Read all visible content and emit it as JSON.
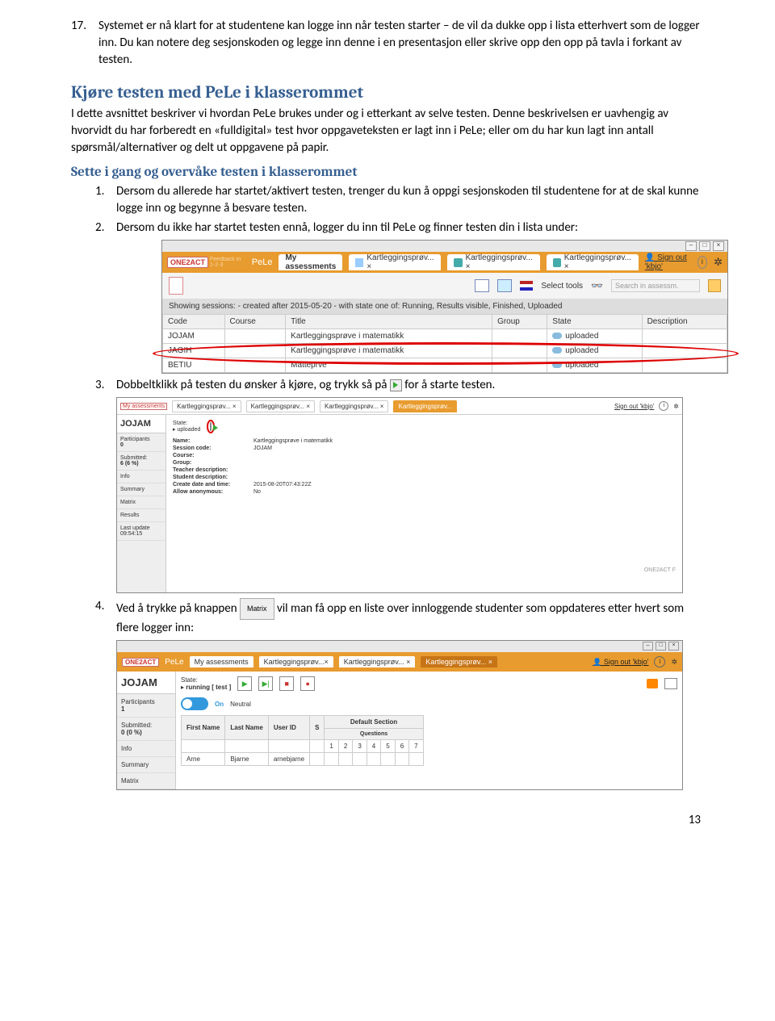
{
  "item17_num": "17.",
  "item17_text": "Systemet er nå klart for at studentene kan logge inn når testen starter – de vil da dukke opp i lista etterhvert som de logger inn. Du kan notere deg sesjonskoden og legge inn denne i en presentasjon eller skrive opp den opp på tavla i forkant av testen.",
  "h_kjor": "Kjøre testen med PeLe i klasserommet",
  "p_kjor": "I dette avsnittet beskriver vi hvordan PeLe brukes under og i etterkant av selve testen. Denne beskrivelsen er uavhengig av hvorvidt du har forberedt en «fulldigital» test hvor oppgaveteksten er lagt inn i PeLe; eller om du har kun lagt inn antall spørsmål/alternativer og delt ut oppgavene på papir.",
  "h_sette": "Sette i gang og overvåke testen i klasserommet",
  "ol": [
    {
      "n": "1.",
      "t": "Dersom du allerede har startet/aktivert testen, trenger du kun å oppgi sesjonskoden til studentene for at de skal kunne logge inn og begynne å besvare testen."
    },
    {
      "n": "2.",
      "t": "Dersom du ikke har startet testen ennå, logger du inn til PeLe og finner testen din i lista under:"
    }
  ],
  "ol3_n": "3.",
  "ol3_a": "Dobbeltklikk på testen du ønsker å kjøre, og trykk så på ",
  "ol3_b": " for å starte testen.",
  "ol4_n": "4.",
  "ol4_a": "Ved å trykke på knappen ",
  "ol4_btn": "Matrix",
  "ol4_b": " vil man få opp en liste over innloggende studenter som oppdateres etter hvert som flere logger inn:",
  "s1": {
    "logo": "ONE2ACT",
    "pele": "PeLe",
    "fb": "Feedback in 1-2-3",
    "tabs": [
      "My assessments",
      "Kartleggingsprøv... ×",
      "Kartleggingsprøv... ×",
      "Kartleggingsprøv... ×"
    ],
    "signout": "Sign out 'kbjo'",
    "select_tools": "Select tools",
    "search_ph": "Search in assessm.",
    "band": "Showing sessions: - created after 2015-05-20 - with state one of: Running, Results visible, Finished, Uploaded",
    "cols": [
      "Code",
      "Course",
      "Title",
      "Group",
      "State",
      "Description"
    ],
    "rows": [
      {
        "code": "JOJAM",
        "title": "Kartleggingsprøve i matematikk",
        "state": "uploaded"
      },
      {
        "code": "JAGIH",
        "title": "Kartleggingsprøve i matematikk",
        "state": "uploaded"
      },
      {
        "code": "BETIU",
        "title": "Matteprve",
        "state": "uploaded"
      }
    ]
  },
  "s2": {
    "tabs": [
      "My assessments",
      "Kartleggingsprøv... ×",
      "Kartleggingsprøv... ×",
      "Kartleggingsprøv... ×",
      "Kartleggingsprøv..."
    ],
    "signout": "Sign out 'kbjo'",
    "code": "JOJAM",
    "state_lbl": "State:",
    "state_val": "uploaded",
    "side": [
      {
        "l": "Participants",
        "v": "0"
      },
      {
        "l": "Submitted:",
        "v": "6 (6 %)"
      },
      {
        "l": "Info",
        "v": ""
      },
      {
        "l": "Summary",
        "v": ""
      },
      {
        "l": "Matrix",
        "v": ""
      },
      {
        "l": "Results",
        "v": ""
      },
      {
        "l": "Last update",
        "v": "09:54:15"
      }
    ],
    "kv": [
      [
        "Name:",
        "Kartleggingsprøve i matematikk"
      ],
      [
        "Session code:",
        "JOJAM"
      ],
      [
        "Course:",
        ""
      ],
      [
        "Group:",
        ""
      ],
      [
        "Teacher description:",
        ""
      ],
      [
        "Student description:",
        ""
      ],
      [
        "Create date and time:",
        "2015-08-20T07:43:22Z"
      ],
      [
        "Allow anonymous:",
        "No"
      ]
    ],
    "footer": "ONE2ACT F"
  },
  "s3": {
    "logo": "ONE2ACT",
    "pele": "PeLe",
    "tabs": [
      "My assessments",
      "Kartleggingsprøv...×",
      "Kartleggingsprøv... ×",
      "Kartleggingsprøv..."
    ],
    "signout": "Sign out 'kbjo'",
    "code": "JOJAM",
    "state_lbl": "State:",
    "state_val": "running [ test ]",
    "side": [
      {
        "l": "Participants",
        "v": "1"
      },
      {
        "l": "Submitted:",
        "v": "0 (0 %)"
      },
      {
        "l": "Info",
        "v": ""
      },
      {
        "l": "Summary",
        "v": ""
      },
      {
        "l": "Matrix",
        "v": ""
      }
    ],
    "toggle": "On",
    "neutral": "Neutral",
    "thead": [
      "First Name",
      "Last Name",
      "User ID",
      "S"
    ],
    "sect": "Default Section",
    "q": "Questions",
    "qn": [
      "1",
      "2",
      "3",
      "4",
      "5",
      "6",
      "7"
    ],
    "row": [
      "Arne",
      "Bjarne",
      "arnebjarne",
      ""
    ]
  },
  "page_num": "13"
}
